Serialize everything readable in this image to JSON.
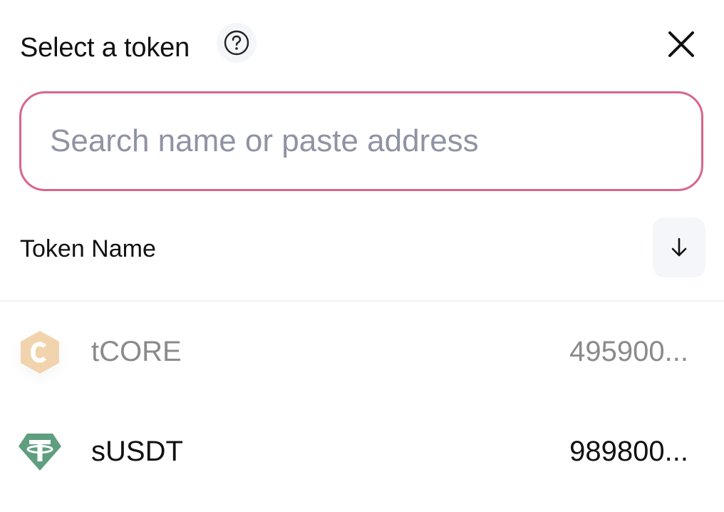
{
  "header": {
    "title": "Select a token",
    "help_icon": "question-circle-icon",
    "close_icon": "close-icon"
  },
  "search": {
    "placeholder": "Search name or paste address",
    "value": "",
    "border_color": "#d9668a"
  },
  "sort": {
    "label": "Token Name",
    "icon": "arrow-down-icon"
  },
  "tokens": [
    {
      "symbol": "tCORE",
      "balance": "495900...",
      "icon": "core-hexagon-icon",
      "color": "#e8b87a",
      "dimmed": true
    },
    {
      "symbol": "sUSDT",
      "balance": "989800...",
      "icon": "tether-icon",
      "color": "#5f9e7e",
      "dimmed": false
    }
  ]
}
